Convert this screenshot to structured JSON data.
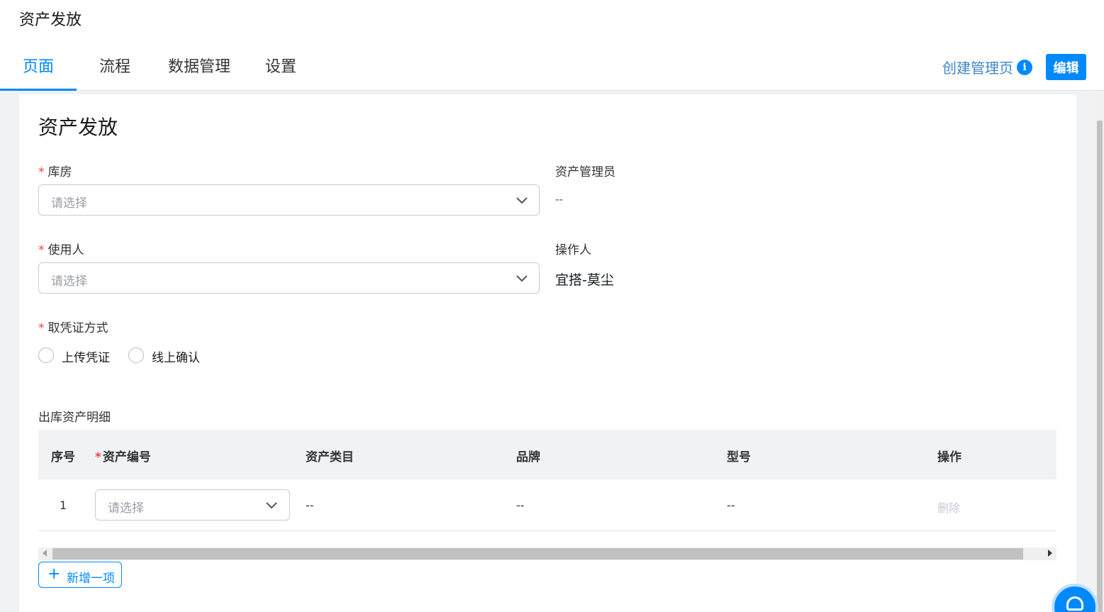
{
  "app": {
    "title": "资产发放"
  },
  "tabs": [
    {
      "label": "页面",
      "active": true
    },
    {
      "label": "流程",
      "active": false
    },
    {
      "label": "数据管理",
      "active": false
    },
    {
      "label": "设置",
      "active": false
    }
  ],
  "header_actions": {
    "create_link": "创建管理页",
    "info_icon": "i",
    "edit_label": "编辑"
  },
  "form": {
    "title": "资产发放",
    "required_mark": "*",
    "warehouse": {
      "label": "库房",
      "placeholder": "请选择"
    },
    "asset_admin": {
      "label": "资产管理员",
      "value": "--"
    },
    "user": {
      "label": "使用人",
      "placeholder": "请选择"
    },
    "operator": {
      "label": "操作人",
      "value": "宜搭-莫尘"
    },
    "voucher": {
      "label": "取凭证方式",
      "options": [
        "上传凭证",
        "线上确认"
      ]
    }
  },
  "table": {
    "title": "出库资产明细",
    "columns": [
      "序号",
      "资产编号",
      "资产类目",
      "品牌",
      "型号",
      "操作"
    ],
    "rows": [
      {
        "index": "1",
        "asset_no_placeholder": "请选择",
        "category": "--",
        "brand": "--",
        "model": "--",
        "action": "删除"
      }
    ],
    "add_label": "新增一项",
    "add_icon": "+"
  },
  "colors": {
    "accent": "#0089ff",
    "required": "#e44444"
  }
}
